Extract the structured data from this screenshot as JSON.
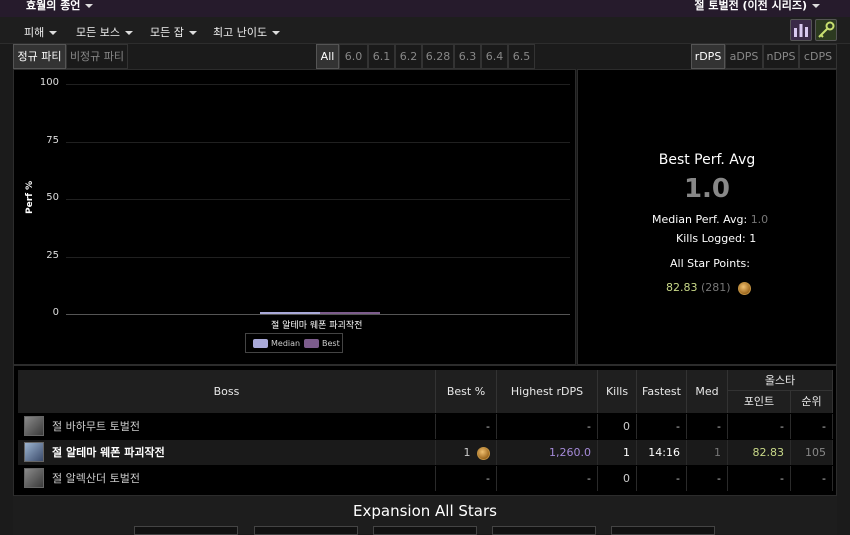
{
  "header": {
    "zone": "효월의 종언",
    "encounter_group": "절 토벌전 (이전 시리즈)"
  },
  "menu": {
    "items": [
      {
        "label": "피해"
      },
      {
        "label": "모든 보스"
      },
      {
        "label": "모든 잡"
      },
      {
        "label": "최고 난이도"
      }
    ]
  },
  "filters": {
    "party_tabs": [
      "정규 파티",
      "비정규 파티"
    ],
    "party_active": "정규 파티",
    "patch_tabs": [
      "All",
      "6.0",
      "6.1",
      "6.2",
      "6.28",
      "6.3",
      "6.4",
      "6.5"
    ],
    "patch_active": "All",
    "metric_tabs": [
      "rDPS",
      "aDPS",
      "nDPS",
      "cDPS"
    ],
    "metric_active": "rDPS"
  },
  "chart_data": {
    "type": "bar",
    "categories": [
      "절 알테마 웨폰 파괴작전"
    ],
    "series": [
      {
        "name": "Median",
        "values": [
          1.0
        ],
        "color": "#a9a9d8"
      },
      {
        "name": "Best",
        "values": [
          1.0
        ],
        "color": "#7c5c8c"
      }
    ],
    "xlabel": "",
    "ylabel": "Perf %",
    "ylim": [
      0,
      100
    ],
    "yticks": [
      "100",
      "75",
      "50",
      "25",
      "0"
    ],
    "legend_position": "bottom-center",
    "grid": true
  },
  "stats": {
    "title": "Best Perf. Avg",
    "best_perf_avg": "1.0",
    "median_label": "Median Perf. Avg:",
    "median_value": "1.0",
    "kills_label": "Kills Logged:",
    "kills_value": "1",
    "allstar_label": "All Star Points:",
    "allstar_points": "82.83",
    "allstar_rank": "(281)"
  },
  "table": {
    "headers": {
      "boss": "Boss",
      "best": "Best %",
      "highest": "Highest rDPS",
      "kills": "Kills",
      "fastest": "Fastest",
      "med": "Med",
      "allstar": "올스타",
      "points": "포인트",
      "rank": "순위"
    },
    "rows": [
      {
        "boss": "절 바하무트 토벌전",
        "best": "",
        "best_medal": "-",
        "highest": "-",
        "kills": "0",
        "fastest": "-",
        "med": "-",
        "points": "-",
        "rank": "-",
        "highlight": false
      },
      {
        "boss": "절 알테마 웨폰 파괴작전",
        "best": "1",
        "best_medal": "",
        "highest": "1,260.0",
        "kills": "1",
        "fastest": "14:16",
        "med": "1",
        "points": "82.83",
        "rank": "105",
        "highlight": true
      },
      {
        "boss": "절 알렉산더 토벌전",
        "best": "",
        "best_medal": "-",
        "highest": "-",
        "kills": "0",
        "fastest": "-",
        "med": "-",
        "points": "-",
        "rank": "-",
        "highlight": false
      }
    ]
  },
  "expansion": {
    "title": "Expansion All Stars"
  },
  "colors": {
    "median": "#a9a9d8",
    "best": "#7c5c8c",
    "highest_dps": "#a58ad8",
    "points": "#c8d888",
    "active_boss": "#ffffff"
  }
}
